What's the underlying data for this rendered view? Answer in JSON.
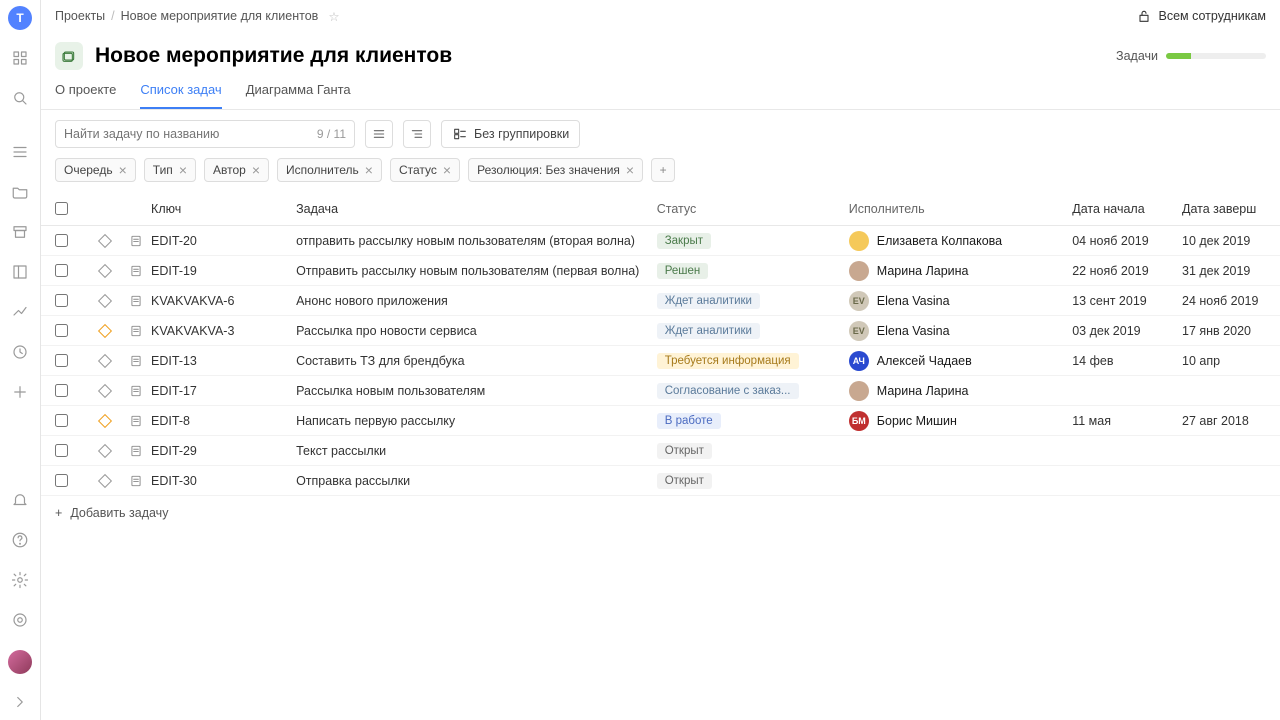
{
  "breadcrumbs": {
    "root": "Проекты",
    "current": "Новое мероприятие для клиентов"
  },
  "visibility_label": "Всем сотрудникам",
  "project_title": "Новое мероприятие для клиентов",
  "tasks_label": "Задачи",
  "tabs": {
    "about": "О проекте",
    "list": "Список задач",
    "gantt": "Диаграмма Ганта"
  },
  "search": {
    "placeholder": "Найти задачу по названию",
    "count": "9 / 11"
  },
  "grouping_label": "Без группировки",
  "filters": {
    "queue": "Очередь",
    "type": "Тип",
    "author": "Автор",
    "assignee": "Исполнитель",
    "status": "Статус",
    "resolution": "Резолюция: Без значения"
  },
  "columns": {
    "key": "Ключ",
    "task": "Задача",
    "status": "Статус",
    "assignee": "Исполнитель",
    "start": "Дата начала",
    "end": "Дата заверш"
  },
  "rows": [
    {
      "key": "EDIT-20",
      "task": "отправить рассылку новым пользователям (вторая волна)",
      "status": "Закрыт",
      "status_cls": "st-closed",
      "assignee": "Елизавета Колпакова",
      "av": "av1",
      "initials": "",
      "start": "04 нояб 2019",
      "end": "10 дек 2019",
      "pri": "normal"
    },
    {
      "key": "EDIT-19",
      "task": "Отправить рассылку новым пользователям (первая волна)",
      "status": "Решен",
      "status_cls": "st-resolved",
      "assignee": "Марина Ларина",
      "av": "av2",
      "initials": "",
      "start": "22 нояб 2019",
      "end": "31 дек 2019",
      "pri": "normal"
    },
    {
      "key": "KVAKVAKVA-6",
      "task": "Анонс нового приложения",
      "status": "Ждет аналитики",
      "status_cls": "st-wait",
      "assignee": "Elena Vasina",
      "av": "av3",
      "initials": "EV",
      "start": "13 сент 2019",
      "end": "24 нояб 2019",
      "pri": "normal"
    },
    {
      "key": "KVAKVAKVA-3",
      "task": "Рассылка про новости сервиса",
      "status": "Ждет аналитики",
      "status_cls": "st-wait",
      "assignee": "Elena Vasina",
      "av": "av3",
      "initials": "EV",
      "start": "03 дек 2019",
      "end": "17 янв 2020",
      "pri": "warn"
    },
    {
      "key": "EDIT-13",
      "task": "Составить ТЗ для брендбука",
      "status": "Требуется информация",
      "status_cls": "st-info",
      "assignee": "Алексей Чадаев",
      "av": "av4",
      "initials": "АЧ",
      "start": "14 фев",
      "end": "10 апр",
      "pri": "normal"
    },
    {
      "key": "EDIT-17",
      "task": "Рассылка новым пользователям",
      "status": "Согласование с заказ...",
      "status_cls": "st-agree",
      "assignee": "Марина Ларина",
      "av": "av2",
      "initials": "",
      "start": "",
      "end": "",
      "pri": "normal"
    },
    {
      "key": "EDIT-8",
      "task": "Написать первую рассылку",
      "status": "В работе",
      "status_cls": "st-work",
      "assignee": "Борис Мишин",
      "av": "av5",
      "initials": "БМ",
      "start": "11 мая",
      "end": "27 авг 2018",
      "pri": "warn"
    },
    {
      "key": "EDIT-29",
      "task": "Текст рассылки",
      "status": "Открыт",
      "status_cls": "st-open",
      "assignee": "",
      "av": "",
      "initials": "",
      "start": "",
      "end": "",
      "pri": "normal"
    },
    {
      "key": "EDIT-30",
      "task": "Отправка рассылки",
      "status": "Открыт",
      "status_cls": "st-open",
      "assignee": "",
      "av": "",
      "initials": "",
      "start": "",
      "end": "",
      "pri": "normal"
    }
  ],
  "add_row_label": "Добавить задачу"
}
